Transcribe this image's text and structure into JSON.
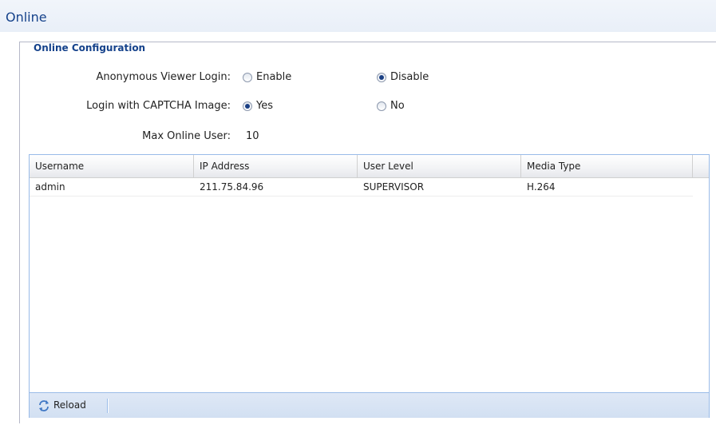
{
  "page": {
    "title": "Online"
  },
  "config": {
    "legend": "Online Configuration",
    "anonymous": {
      "label": "Anonymous Viewer Login:",
      "options": [
        "Enable",
        "Disable"
      ],
      "selected": "Disable"
    },
    "captcha": {
      "label": "Login with CAPTCHA Image:",
      "options": [
        "Yes",
        "No"
      ],
      "selected": "Yes"
    },
    "max_users": {
      "label": "Max Online User:",
      "value": "10"
    }
  },
  "grid": {
    "columns": [
      "Username",
      "IP Address",
      "User Level",
      "Media Type"
    ],
    "rows": [
      [
        "admin",
        "211.75.84.96",
        "SUPERVISOR",
        "H.264"
      ]
    ]
  },
  "toolbar": {
    "reload_label": "Reload",
    "reload_icon": "refresh-icon"
  },
  "colors": {
    "title": "#15428b",
    "border": "#99bbe8",
    "toolbar": "#d2e0f2"
  }
}
